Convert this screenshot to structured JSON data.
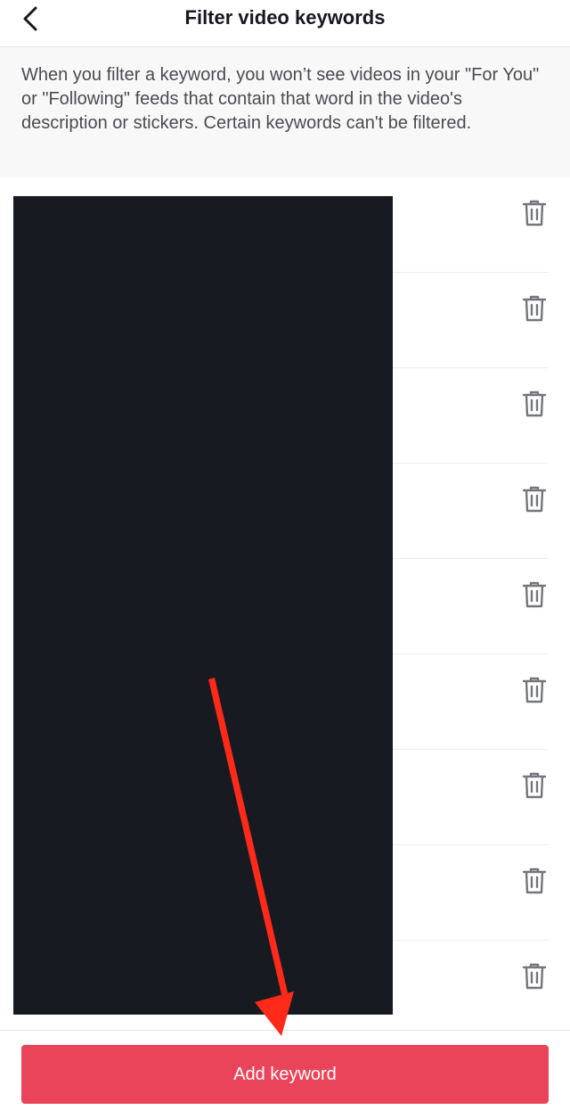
{
  "header": {
    "title": "Filter video keywords",
    "back_icon": "chevron-left-icon"
  },
  "info": {
    "text": "When you filter a keyword, you won’t see videos in your \"For You\" or \"Following\" feeds that contain that word in the video's description or stickers. Certain keywords can't be filtered."
  },
  "keywords": {
    "items": [
      {
        "label": "",
        "delete_icon": "trash-icon"
      },
      {
        "label": "",
        "delete_icon": "trash-icon"
      },
      {
        "label": "",
        "delete_icon": "trash-icon"
      },
      {
        "label": "",
        "delete_icon": "trash-icon"
      },
      {
        "label": "",
        "delete_icon": "trash-icon"
      },
      {
        "label": "",
        "delete_icon": "trash-icon"
      },
      {
        "label": "",
        "delete_icon": "trash-icon"
      },
      {
        "label": "",
        "delete_icon": "trash-icon"
      },
      {
        "label": "",
        "delete_icon": "trash-icon"
      }
    ]
  },
  "footer": {
    "add_label": "Add keyword"
  },
  "colors": {
    "accent": "#ea445a",
    "annotation_arrow": "#ff2a1a",
    "redaction": "#181a22",
    "icon_gray": "#75767c"
  }
}
